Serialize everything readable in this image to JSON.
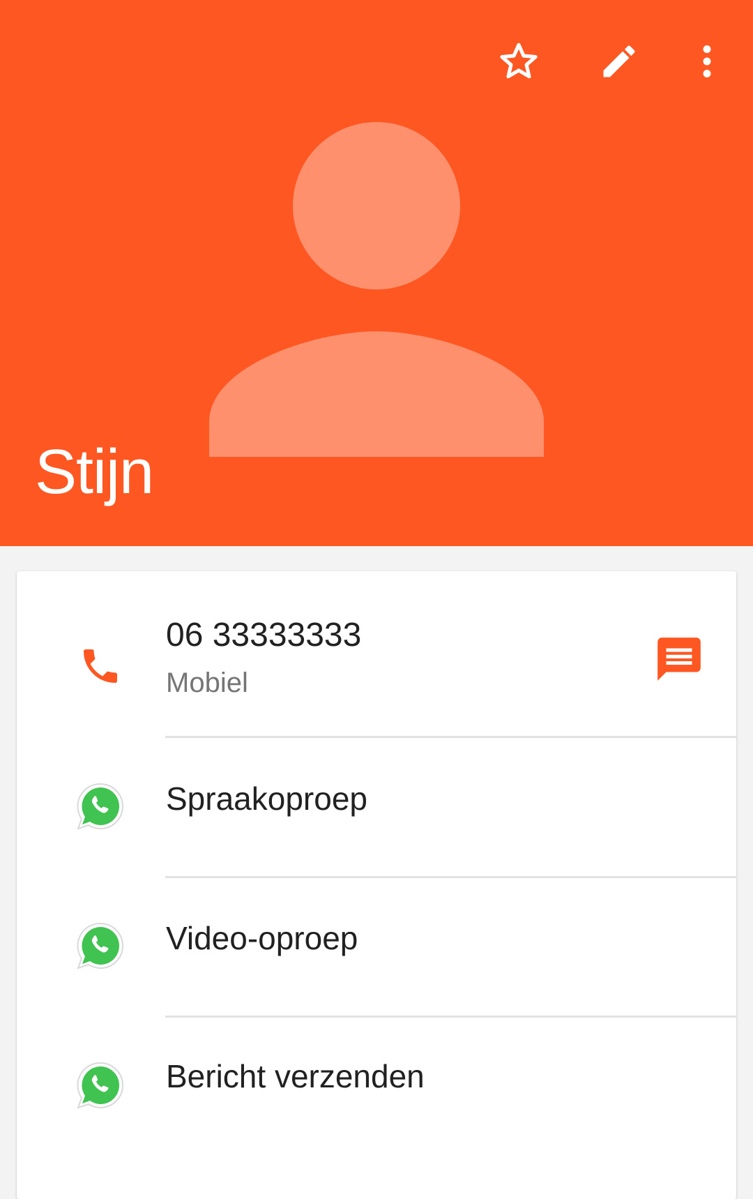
{
  "header": {
    "background_color": "#ff5722",
    "contact_name": "Stijn",
    "actions": [
      {
        "name": "star-icon",
        "label": "Favorite"
      },
      {
        "name": "edit-pencil-icon",
        "label": "Edit"
      },
      {
        "name": "more-vert-icon",
        "label": "More options"
      }
    ]
  },
  "phone": {
    "number": "06 33333333",
    "type": "Mobiel",
    "call_icon": "phone-icon",
    "message_icon": "message-icon"
  },
  "whatsapp_actions": [
    {
      "label": "Spraakoproep",
      "icon": "whatsapp-icon"
    },
    {
      "label": "Video-oproep",
      "icon": "whatsapp-icon"
    },
    {
      "label": "Bericht verzenden",
      "icon": "whatsapp-icon"
    }
  ],
  "colors": {
    "accent": "#ff5722",
    "avatar_silhouette": "#ff906d",
    "whatsapp_green": "#40c351"
  }
}
